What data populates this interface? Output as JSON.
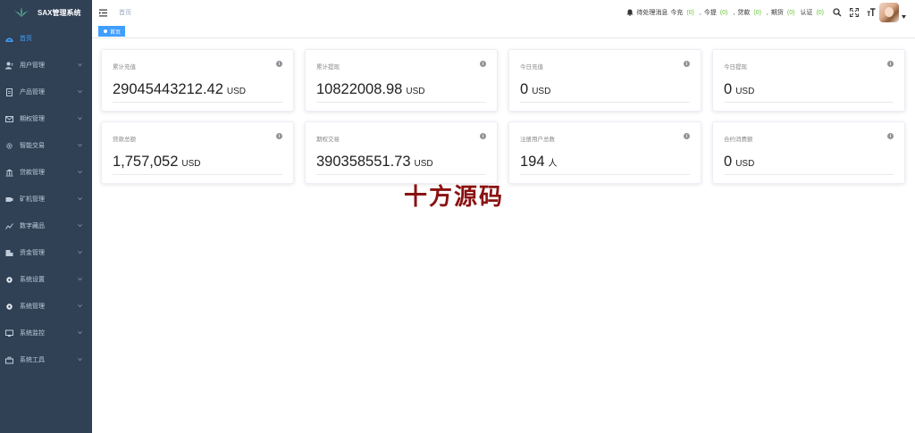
{
  "app": {
    "title": "SAX管理系统"
  },
  "sidebar": {
    "items": [
      {
        "label": "首页",
        "icon": "dashboard-icon",
        "active": true,
        "expandable": false
      },
      {
        "label": "用户管理",
        "icon": "user-icon",
        "expandable": true
      },
      {
        "label": "产品管理",
        "icon": "document-icon",
        "expandable": true
      },
      {
        "label": "期权管理",
        "icon": "mail-icon",
        "expandable": true
      },
      {
        "label": "智能交易",
        "icon": "gear-icon",
        "expandable": true
      },
      {
        "label": "贷款管理",
        "icon": "bank-icon",
        "expandable": true
      },
      {
        "label": "矿机管理",
        "icon": "machine-icon",
        "expandable": true
      },
      {
        "label": "数字藏品",
        "icon": "chart-line-icon",
        "expandable": true
      },
      {
        "label": "资金管理",
        "icon": "wallet-icon",
        "expandable": true
      },
      {
        "label": "系统设置",
        "icon": "settings-icon",
        "expandable": true
      },
      {
        "label": "系统管理",
        "icon": "cog-icon",
        "expandable": true
      },
      {
        "label": "系统监控",
        "icon": "monitor-icon",
        "expandable": true
      },
      {
        "label": "系统工具",
        "icon": "toolbox-icon",
        "expandable": true
      }
    ]
  },
  "header": {
    "breadcrumb": "首页",
    "pending_label": "待处理消息",
    "notifications": [
      {
        "label": "今充",
        "count": "(0)"
      },
      {
        "label": "今提",
        "count": "(0)"
      },
      {
        "label": "贷款",
        "count": "(0)"
      },
      {
        "label": "期货",
        "count": "(0)"
      },
      {
        "label": "认证",
        "count": "(0)"
      }
    ]
  },
  "tags": {
    "active": "首页"
  },
  "cards": [
    {
      "label": "累计充值",
      "value": "29045443212.42",
      "unit": "USD"
    },
    {
      "label": "累计提现",
      "value": "10822008.98",
      "unit": "USD"
    },
    {
      "label": "今日充值",
      "value": "0",
      "unit": "USD"
    },
    {
      "label": "今日提现",
      "value": "0",
      "unit": "USD"
    },
    {
      "label": "贷款总额",
      "value": "1,757,052",
      "unit": "USD"
    },
    {
      "label": "期权交易",
      "value": "390358551.73",
      "unit": "USD"
    },
    {
      "label": "注册用户总数",
      "value": "194",
      "unit": "人"
    },
    {
      "label": "合约消费额",
      "value": "0",
      "unit": "USD"
    }
  ],
  "watermark": "十方源码",
  "colors": {
    "sidebar_bg": "#304156",
    "sidebar_text": "#bfcbd9",
    "accent": "#409eff",
    "count": "#67c23a",
    "watermark": "#8b1111"
  }
}
